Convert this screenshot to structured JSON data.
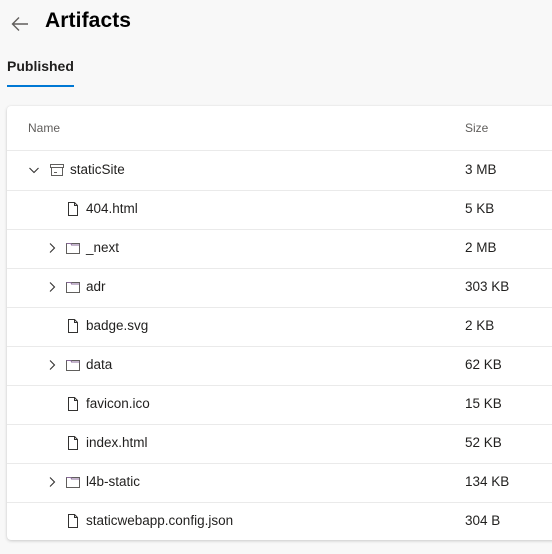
{
  "header": {
    "title": "Artifacts",
    "back_icon": "arrow-left-icon"
  },
  "tabs": [
    {
      "label": "Published",
      "active": true
    }
  ],
  "table": {
    "columns": {
      "name": "Name",
      "size": "Size"
    },
    "rows": [
      {
        "name": "staticSite",
        "size": "3 MB",
        "type": "artifact",
        "level": 0,
        "expanded": true,
        "icon": "artifact-box-icon"
      },
      {
        "name": "404.html",
        "size": "5 KB",
        "type": "file",
        "level": 1,
        "icon": "file-icon"
      },
      {
        "name": "_next",
        "size": "2 MB",
        "type": "folder",
        "level": 1,
        "expanded": false,
        "icon": "folder-icon"
      },
      {
        "name": "adr",
        "size": "303 KB",
        "type": "folder",
        "level": 1,
        "expanded": false,
        "icon": "folder-icon"
      },
      {
        "name": "badge.svg",
        "size": "2 KB",
        "type": "file",
        "level": 1,
        "icon": "file-icon"
      },
      {
        "name": "data",
        "size": "62 KB",
        "type": "folder",
        "level": 1,
        "expanded": false,
        "icon": "folder-icon"
      },
      {
        "name": "favicon.ico",
        "size": "15 KB",
        "type": "file",
        "level": 1,
        "icon": "file-icon"
      },
      {
        "name": "index.html",
        "size": "52 KB",
        "type": "file",
        "level": 1,
        "icon": "file-icon"
      },
      {
        "name": "l4b-static",
        "size": "134 KB",
        "type": "folder",
        "level": 1,
        "expanded": false,
        "icon": "folder-icon"
      },
      {
        "name": "staticwebapp.config.json",
        "size": "304 B",
        "type": "file",
        "level": 1,
        "icon": "file-icon"
      }
    ]
  },
  "colors": {
    "accent": "#0078d4",
    "folder_icon": "#8a6a9a"
  }
}
